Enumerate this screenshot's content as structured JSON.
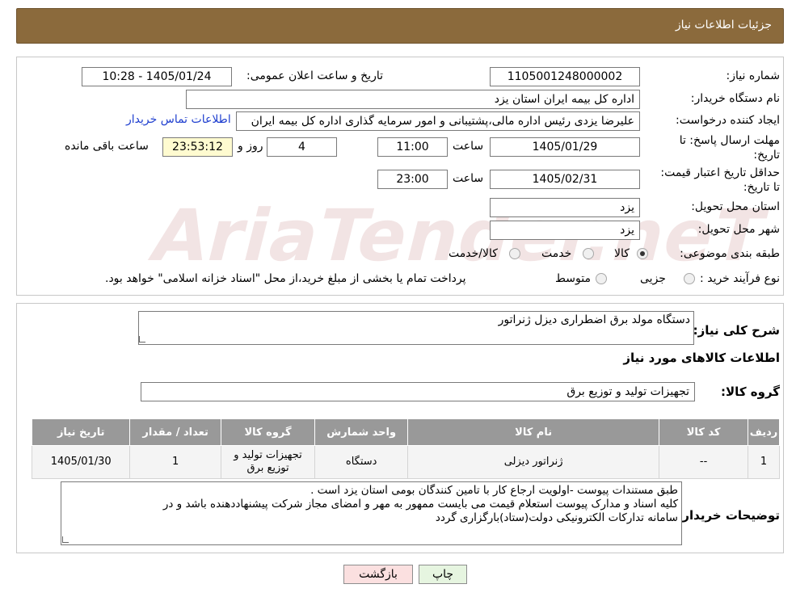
{
  "header": {
    "title": "جزئیات اطلاعات نیاز"
  },
  "form": {
    "need_number_label": "شماره نیاز:",
    "need_number": "1105001248000002",
    "announce_label": "تاریخ و ساعت اعلان عمومی:",
    "announce_value": "1405/01/24 - 10:28",
    "buyer_org_label": "نام دستگاه خریدار:",
    "buyer_org": "اداره کل بیمه ایران استان یزد",
    "creator_label": "ایجاد کننده درخواست:",
    "creator": "علیرضا یزدی رئیس اداره مالی،پشتیبانی و امور سرمایه گذاری اداره کل بیمه ایران",
    "buyer_contact_link": "اطلاعات تماس خریدار",
    "deadline_label": "مهلت ارسال پاسخ: تا تاریخ:",
    "deadline_date": "1405/01/29",
    "time_label": "ساعت",
    "deadline_time": "11:00",
    "days_value": "4",
    "days_label": "روز و",
    "remaining_time": "23:53:12",
    "remaining_label": "ساعت باقی مانده",
    "price_validity_label": "حداقل تاریخ اعتبار قیمت: تا تاریخ:",
    "price_validity_date": "1405/02/31",
    "price_validity_time": "23:00",
    "province_label": "استان محل تحویل:",
    "province": "یزد",
    "city_label": "شهر محل تحویل:",
    "city": "یزد",
    "category_label": "طبقه بندی موضوعی:",
    "category_options": [
      "کالا",
      "خدمت",
      "کالا/خدمت"
    ],
    "category_selected": "کالا",
    "process_label": "نوع فرآیند خرید :",
    "process_options": [
      "جزیی",
      "متوسط"
    ],
    "process_note": "پرداخت تمام یا بخشی از مبلغ خرید،از محل \"اسناد خزانه اسلامی\" خواهد بود."
  },
  "need": {
    "summary_label": "شرح کلی نیاز:",
    "summary": "دستگاه مولد برق اضطراری دیزل ژنراتور",
    "goods_info_title": "اطلاعات کالاهای مورد نیاز",
    "goods_group_label": "گروه کالا:",
    "goods_group": "تجهیزات تولید و توزیع برق"
  },
  "table": {
    "headers": [
      "ردیف",
      "کد کالا",
      "نام کالا",
      "واحد شمارش",
      "گروه کالا",
      "تعداد / مقدار",
      "تاریخ نیاز"
    ],
    "rows": [
      [
        "1",
        "--",
        "ژنراتور دیزلی",
        "دستگاه",
        "تجهیزات تولید و توزیع برق",
        "1",
        "1405/01/30"
      ]
    ]
  },
  "buyer_notes": {
    "label": "توضیحات خریدار:",
    "line1": "طبق مستندات پیوست -اولویت ارجاع کار با تامین کنندگان بومی استان یزد است .",
    "line2": "کلیه اسناد و مدارک پیوست استعلام قیمت می بایست ممهور به مهر و امضای مجاز شرکت پیشنهاددهنده باشد و در",
    "line3": "سامانه تدارکات الکترونیکی دولت(ستاد)بارگزاری گردد"
  },
  "buttons": {
    "print": "چاپ",
    "back": "بازگشت"
  },
  "watermark": "AriaTender.neT",
  "colors": {
    "header": "#8b6a3c",
    "link": "#1f3fcf",
    "print_btn": "#e6f5e0",
    "back_btn": "#fbe0e0"
  }
}
